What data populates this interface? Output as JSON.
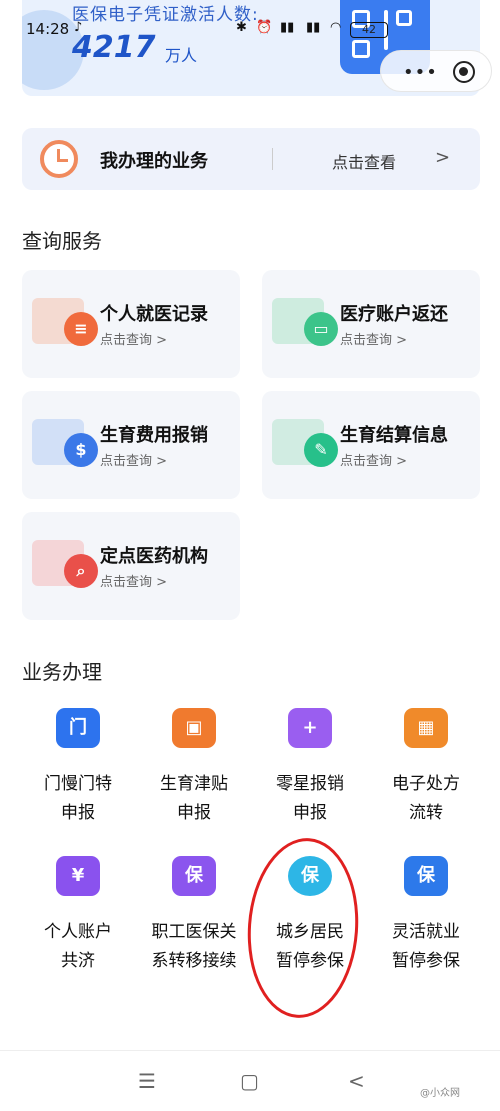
{
  "status_bar": {
    "time": "14:28",
    "battery": "42"
  },
  "banner": {
    "title": "医保电子凭证激活人数:",
    "count": "4217",
    "unit": "万人"
  },
  "my_business": {
    "label": "我办理的业务",
    "link": "点击查看",
    "chevron": ">"
  },
  "query": {
    "section_title": "查询服务",
    "cards": [
      {
        "title": "个人就医记录",
        "sub": "点击查询 >",
        "color": "#f06a3c"
      },
      {
        "title": "医疗账户返还",
        "sub": "点击查询 >",
        "color": "#3cc48a"
      },
      {
        "title": "生育费用报销",
        "sub": "点击查询 >",
        "color": "#3b78e8"
      },
      {
        "title": "生育结算信息",
        "sub": "点击查询 >",
        "color": "#27c08a"
      },
      {
        "title": "定点医药机构",
        "sub": "点击查询 >",
        "color": "#e9504a"
      }
    ]
  },
  "business": {
    "section_title": "业务办理",
    "items": [
      {
        "label": "门慢门特\n申报",
        "glyph": "门",
        "color": "#2d73ee"
      },
      {
        "label": "生育津贴\n申报",
        "glyph": "▣",
        "color": "#f07a2e"
      },
      {
        "label": "零星报销\n申报",
        "glyph": "+",
        "color": "#9a5ef0"
      },
      {
        "label": "电子处方\n流转",
        "glyph": "▦",
        "color": "#f08a2a"
      },
      {
        "label": "个人账户\n共济",
        "glyph": "¥",
        "color": "#8a52ee"
      },
      {
        "label": "职工医保关\n系转移接续",
        "glyph": "保",
        "color": "#8b55ee"
      },
      {
        "label": "城乡居民\n暂停参保",
        "glyph": "保",
        "color": "#2db6e6"
      },
      {
        "label": "灵活就业\n暂停参保",
        "glyph": "保",
        "color": "#2d79ea"
      }
    ]
  },
  "nav": {
    "menu": "☰",
    "home": "▢",
    "back": "<"
  },
  "watermark": "@小众网"
}
